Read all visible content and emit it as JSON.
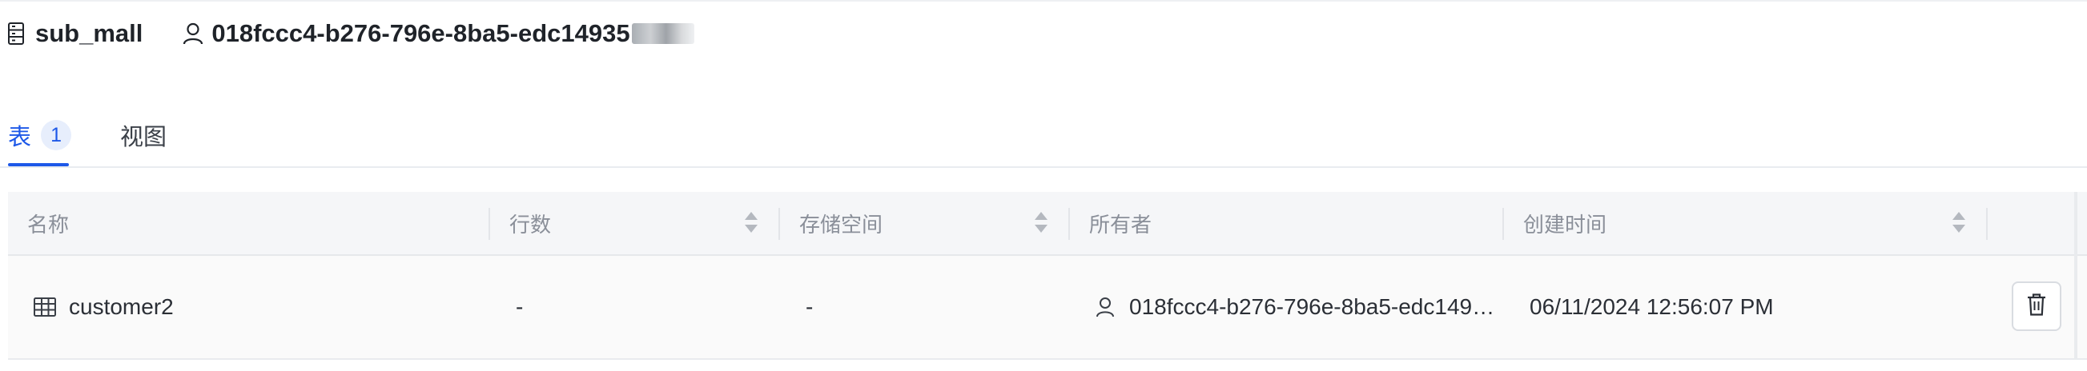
{
  "header": {
    "db_name": "sub_mall",
    "owner_id": "018fccc4-b276-796e-8ba5-edc14935"
  },
  "tabs": [
    {
      "label": "表",
      "count": "1",
      "active": true
    },
    {
      "label": "视图",
      "active": false
    }
  ],
  "table": {
    "columns": [
      "名称",
      "行数",
      "存储空间",
      "所有者",
      "创建时间"
    ],
    "rows": [
      {
        "name": "customer2",
        "row_count": "-",
        "storage": "-",
        "owner": "018fccc4-b276-796e-8ba5-edc149…",
        "created": "06/11/2024 12:56:07 PM"
      }
    ]
  },
  "icons": {
    "database": "database-icon",
    "user": "user-icon",
    "table": "table-icon",
    "delete": "trash-icon",
    "sort": "sort-icon"
  },
  "colors": {
    "accent": "#1d58e8",
    "header_bg": "#f5f6f8",
    "row_bg": "#fafafa"
  }
}
